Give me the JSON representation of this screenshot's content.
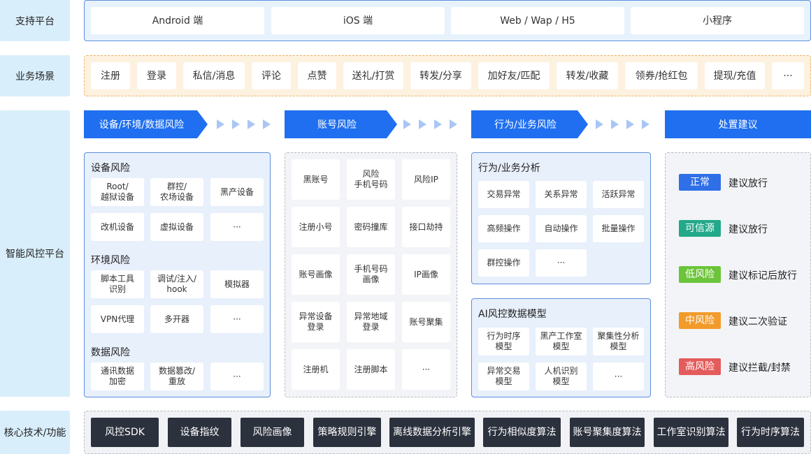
{
  "labels": {
    "platform": "支持平台",
    "scene": "业务场景",
    "risk_platform": "智能风控平台",
    "core_tech": "核心技术/功能"
  },
  "platforms": [
    "Android 端",
    "iOS 端",
    "Web / Wap / H5",
    "小程序"
  ],
  "scenes": [
    "注册",
    "登录",
    "私信/消息",
    "评论",
    "点赞",
    "送礼/打赏",
    "转发/分享",
    "加好友/匹配",
    "转发/收藏",
    "领券/抢红包",
    "提现/充值",
    "···"
  ],
  "flow_headers": [
    "设备/环境/数据风险",
    "账号风险",
    "行为/业务风险",
    "处置建议"
  ],
  "col1": {
    "device_title": "设备风险",
    "device_items": [
      "Root/\n越狱设备",
      "群控/\n农场设备",
      "黑产设备",
      "改机设备",
      "虚拟设备",
      "···"
    ],
    "env_title": "环境风险",
    "env_items": [
      "脚本工具\n识别",
      "调试/注入/\nhook",
      "模拟器",
      "VPN代理",
      "多开器",
      "···"
    ],
    "data_title": "数据风险",
    "data_items": [
      "通讯数据\n加密",
      "数据篡改/\n重放",
      "···"
    ]
  },
  "col2": {
    "items": [
      "黑账号",
      "风险\n手机号码",
      "风险IP",
      "注册小号",
      "密码撞库",
      "接口劫持",
      "账号画像",
      "手机号码\n画像",
      "IP画像",
      "异常设备\n登录",
      "异常地域\n登录",
      "账号聚集",
      "注册机",
      "注册脚本",
      "···"
    ]
  },
  "col3": {
    "behavior_title": "行为/业务分析",
    "behavior_items": [
      "交易异常",
      "关系异常",
      "活跃异常",
      "高频操作",
      "自动操作",
      "批量操作",
      "群控操作",
      "···"
    ],
    "ai_title": "AI风控数据模型",
    "ai_items": [
      "行为时序\n模型",
      "黑产工作室\n模型",
      "聚集性分析\n模型",
      "异常交易\n模型",
      "人机识别\n模型",
      "···"
    ]
  },
  "col4": {
    "levels": [
      {
        "badge": "正常",
        "advice": "建议放行",
        "color": "#2f6fe8"
      },
      {
        "badge": "可信源",
        "advice": "建议放行",
        "color": "#23a98a"
      },
      {
        "badge": "低风险",
        "advice": "建议标记后放行",
        "color": "#6cc43a"
      },
      {
        "badge": "中风险",
        "advice": "建议二次验证",
        "color": "#f29b2b"
      },
      {
        "badge": "高风险",
        "advice": "建议拦截/封禁",
        "color": "#e45b5b"
      }
    ]
  },
  "core_tech": [
    "风控SDK",
    "设备指纹",
    "风险画像",
    "策略规则引擎",
    "离线数据分析引擎",
    "行为相似度算法",
    "账号聚集度算法",
    "工作室识别算法",
    "行为时序算法"
  ],
  "colors": {
    "accent": "#1f6ff0",
    "label_bg": "#d9eefb",
    "tech_bg": "#2b313d"
  }
}
